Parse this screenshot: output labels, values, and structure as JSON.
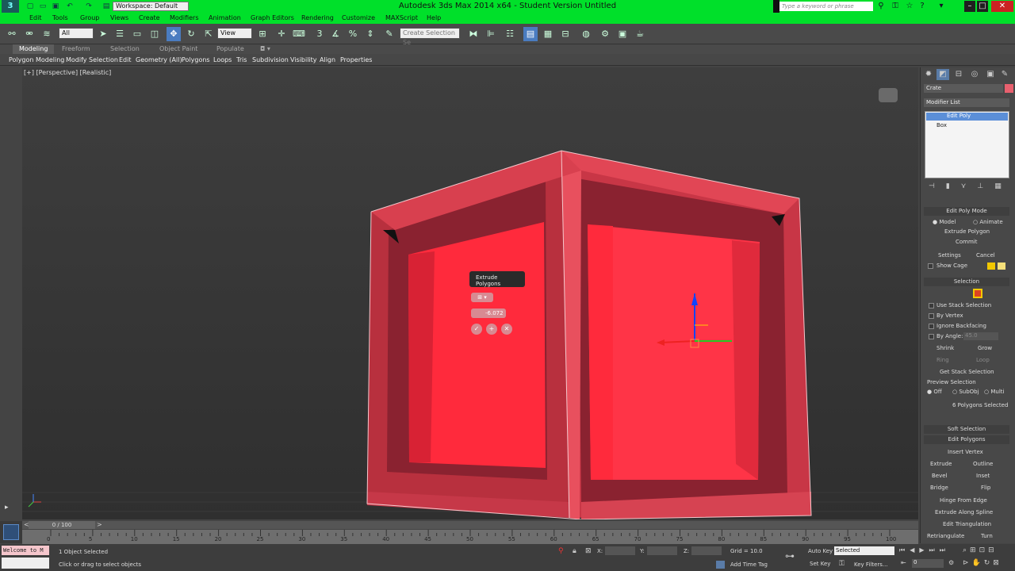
{
  "window": {
    "title": "Autodesk 3ds Max  2014 x64  -  Student Version    Untitled",
    "workspace": "Workspace: Default",
    "search_placeholder": "Type a keyword or phrase"
  },
  "menu": [
    "Edit",
    "Tools",
    "Group",
    "Views",
    "Create",
    "Modifiers",
    "Animation",
    "Graph Editors",
    "Rendering",
    "Customize",
    "MAXScript",
    "Help"
  ],
  "toolbar": {
    "filter": "All",
    "ref_coord": "View",
    "named_sel": "Create Selection Se"
  },
  "ribbon": {
    "tabs": [
      "Modeling",
      "Freeform",
      "Selection",
      "Object Paint",
      "Populate"
    ],
    "items": [
      "Polygon Modeling",
      "Modify Selection",
      "Edit",
      "Geometry (All)",
      "Polygons",
      "Loops",
      "Tris",
      "Subdivision",
      "Visibility",
      "Align",
      "Properties"
    ]
  },
  "viewport": {
    "label": "[+] [Perspective] [Realistic]",
    "caddy_title": "Extrude Polygons",
    "caddy_value": "-6.072"
  },
  "panel": {
    "object_name": "Crate",
    "modifier_list": "Modifier List",
    "stack": [
      "Edit Poly",
      "Box"
    ],
    "edit_poly_mode": "Edit Poly Mode",
    "model": "Model",
    "animate": "Animate",
    "op": "Extrude Polygon",
    "commit": "Commit",
    "settings": "Settings",
    "cancel": "Cancel",
    "show_cage": "Show Cage",
    "selection": "Selection",
    "use_stack": "Use Stack Selection",
    "by_vertex": "By Vertex",
    "ignore_backfacing": "Ignore Backfacing",
    "by_angle": "By Angle:",
    "angle_val": "45.0",
    "shrink": "Shrink",
    "grow": "Grow",
    "ring": "Ring",
    "loop": "Loop",
    "get_stack": "Get Stack Selection",
    "preview": "Preview Selection",
    "off": "Off",
    "subobj": "SubObj",
    "multi": "Multi",
    "sel_status": "6 Polygons Selected",
    "soft_sel": "Soft Selection",
    "edit_polys": "Edit Polygons",
    "insert_vertex": "Insert Vertex",
    "extrude": "Extrude",
    "outline": "Outline",
    "bevel": "Bevel",
    "inset": "Inset",
    "bridge": "Bridge",
    "flip": "Flip",
    "hinge": "Hinge From Edge",
    "extrude_spline": "Extrude Along Spline",
    "edit_tri": "Edit Triangulation",
    "retriangulate": "Retriangulate",
    "turn": "Turn"
  },
  "timeline": {
    "frame": "0 / 100",
    "ticks": [
      "0",
      "5",
      "10",
      "15",
      "20",
      "25",
      "30",
      "35",
      "40",
      "45",
      "50",
      "55",
      "60",
      "65",
      "70",
      "75",
      "80",
      "85",
      "90",
      "95",
      "100"
    ]
  },
  "status": {
    "welcome": "Welcome to M",
    "selected": "1 Object Selected",
    "prompt": "Click or drag to select objects",
    "x": "X:",
    "y": "Y:",
    "z": "Z:",
    "grid": "Grid = 10.0",
    "add_time_tag": "Add Time Tag",
    "auto_key": "Auto Key",
    "selected_dd": "Selected",
    "set_key": "Set Key",
    "key_filters": "Key Filters...",
    "frame_val": "0"
  },
  "colors": {
    "title_bar": "#00e02a",
    "object": "#e63a4e",
    "selected_face": "#ff2a3c"
  }
}
